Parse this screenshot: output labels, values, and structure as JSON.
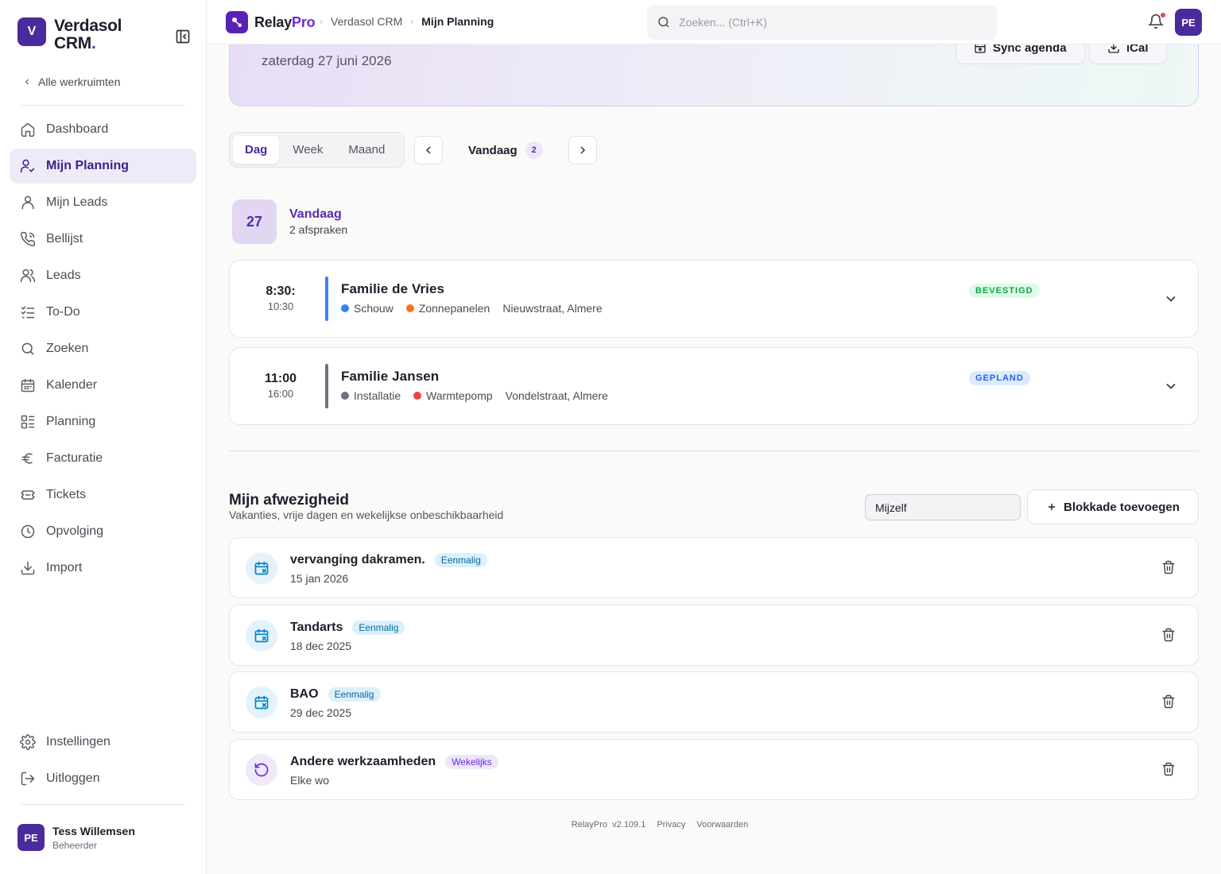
{
  "workspace": {
    "badge": "V",
    "name": "Verdasol CRM",
    "dot": "."
  },
  "sidebar": {
    "all_workspaces": "Alle werkruimten",
    "items": [
      {
        "label": "Dashboard",
        "icon": "home-icon"
      },
      {
        "label": "Mijn Planning",
        "icon": "user-check-icon",
        "active": true
      },
      {
        "label": "Mijn Leads",
        "icon": "user-icon"
      },
      {
        "label": "Bellijst",
        "icon": "phone-icon"
      },
      {
        "label": "Leads",
        "icon": "users-icon"
      },
      {
        "label": "To-Do",
        "icon": "checklist-icon"
      },
      {
        "label": "Zoeken",
        "icon": "search-icon"
      },
      {
        "label": "Kalender",
        "icon": "calendar-icon"
      },
      {
        "label": "Planning",
        "icon": "layout-list-icon"
      },
      {
        "label": "Facturatie",
        "icon": "euro-icon"
      },
      {
        "label": "Tickets",
        "icon": "ticket-icon"
      },
      {
        "label": "Opvolging",
        "icon": "clock-icon"
      },
      {
        "label": "Import",
        "icon": "download-icon"
      }
    ],
    "bottom": [
      {
        "label": "Instellingen",
        "icon": "gear-icon"
      },
      {
        "label": "Uitloggen",
        "icon": "logout-icon"
      }
    ],
    "user": {
      "initials": "PE",
      "name": "Tess Willemsen",
      "role": "Beheerder"
    }
  },
  "topbar": {
    "brand": "Relay",
    "brand_accent": "Pro",
    "breadcrumb": [
      "Verdasol CRM",
      "Mijn Planning"
    ],
    "search_placeholder": "Zoeken... (Ctrl+K)",
    "avatar": "PE"
  },
  "hero": {
    "date": "zaterdag 27 juni 2026",
    "sync_label": "Sync agenda",
    "ical_label": "iCal"
  },
  "view": {
    "tabs": [
      "Dag",
      "Week",
      "Maand"
    ],
    "active": "Dag",
    "today_label": "Vandaag",
    "today_count": "2"
  },
  "day": {
    "number": "27",
    "title": "Vandaag",
    "subtitle": "2 afspraken"
  },
  "appointments": [
    {
      "start": "8:30:",
      "end": "10:30",
      "title": "Familie de Vries",
      "type": "Schouw",
      "type_color": "#3b82f6",
      "product": "Zonnepanelen",
      "product_color": "#f97316",
      "address": "Nieuwstraat, Almere",
      "status": "BEVESTIGD",
      "status_color": "#16a34a",
      "status_bg": "#dcfce7",
      "bar_color": "#3b82f6"
    },
    {
      "start": "11:00",
      "end": "16:00",
      "title": "Familie Jansen",
      "type": "Installatie",
      "type_color": "#6b7280",
      "product": "Warmtepomp",
      "product_color": "#ef4444",
      "address": "Vondelstraat, Almere",
      "status": "GEPLAND",
      "status_color": "#2563eb",
      "status_bg": "#dbeafe",
      "bar_color": "#6b7280"
    }
  ],
  "absence": {
    "title": "Mijn afwezigheid",
    "subtitle": "Vakanties, vrije dagen en wekelijkse onbeschikbaarheid",
    "select_value": "Mijzelf",
    "add_label": "Blokkade toevoegen",
    "items": [
      {
        "title": "vervanging dakramen.",
        "tag": "Eenmalig",
        "date": "15 jan 2026",
        "kind": "once"
      },
      {
        "title": "Tandarts",
        "tag": "Eenmalig",
        "date": "18 dec 2025",
        "kind": "once"
      },
      {
        "title": "BAO",
        "tag": "Eenmalig",
        "date": "29 dec 2025",
        "kind": "once"
      },
      {
        "title": "Andere werkzaamheden",
        "tag": "Wekelijks",
        "date": "Elke wo",
        "kind": "weekly"
      }
    ]
  },
  "footer": {
    "product": "RelayPro",
    "version": "v2.109.1",
    "privacy": "Privacy",
    "terms": "Voorwaarden"
  },
  "colors": {
    "accent": "#4b2a9c",
    "accent_light": "#eeeaf8"
  }
}
